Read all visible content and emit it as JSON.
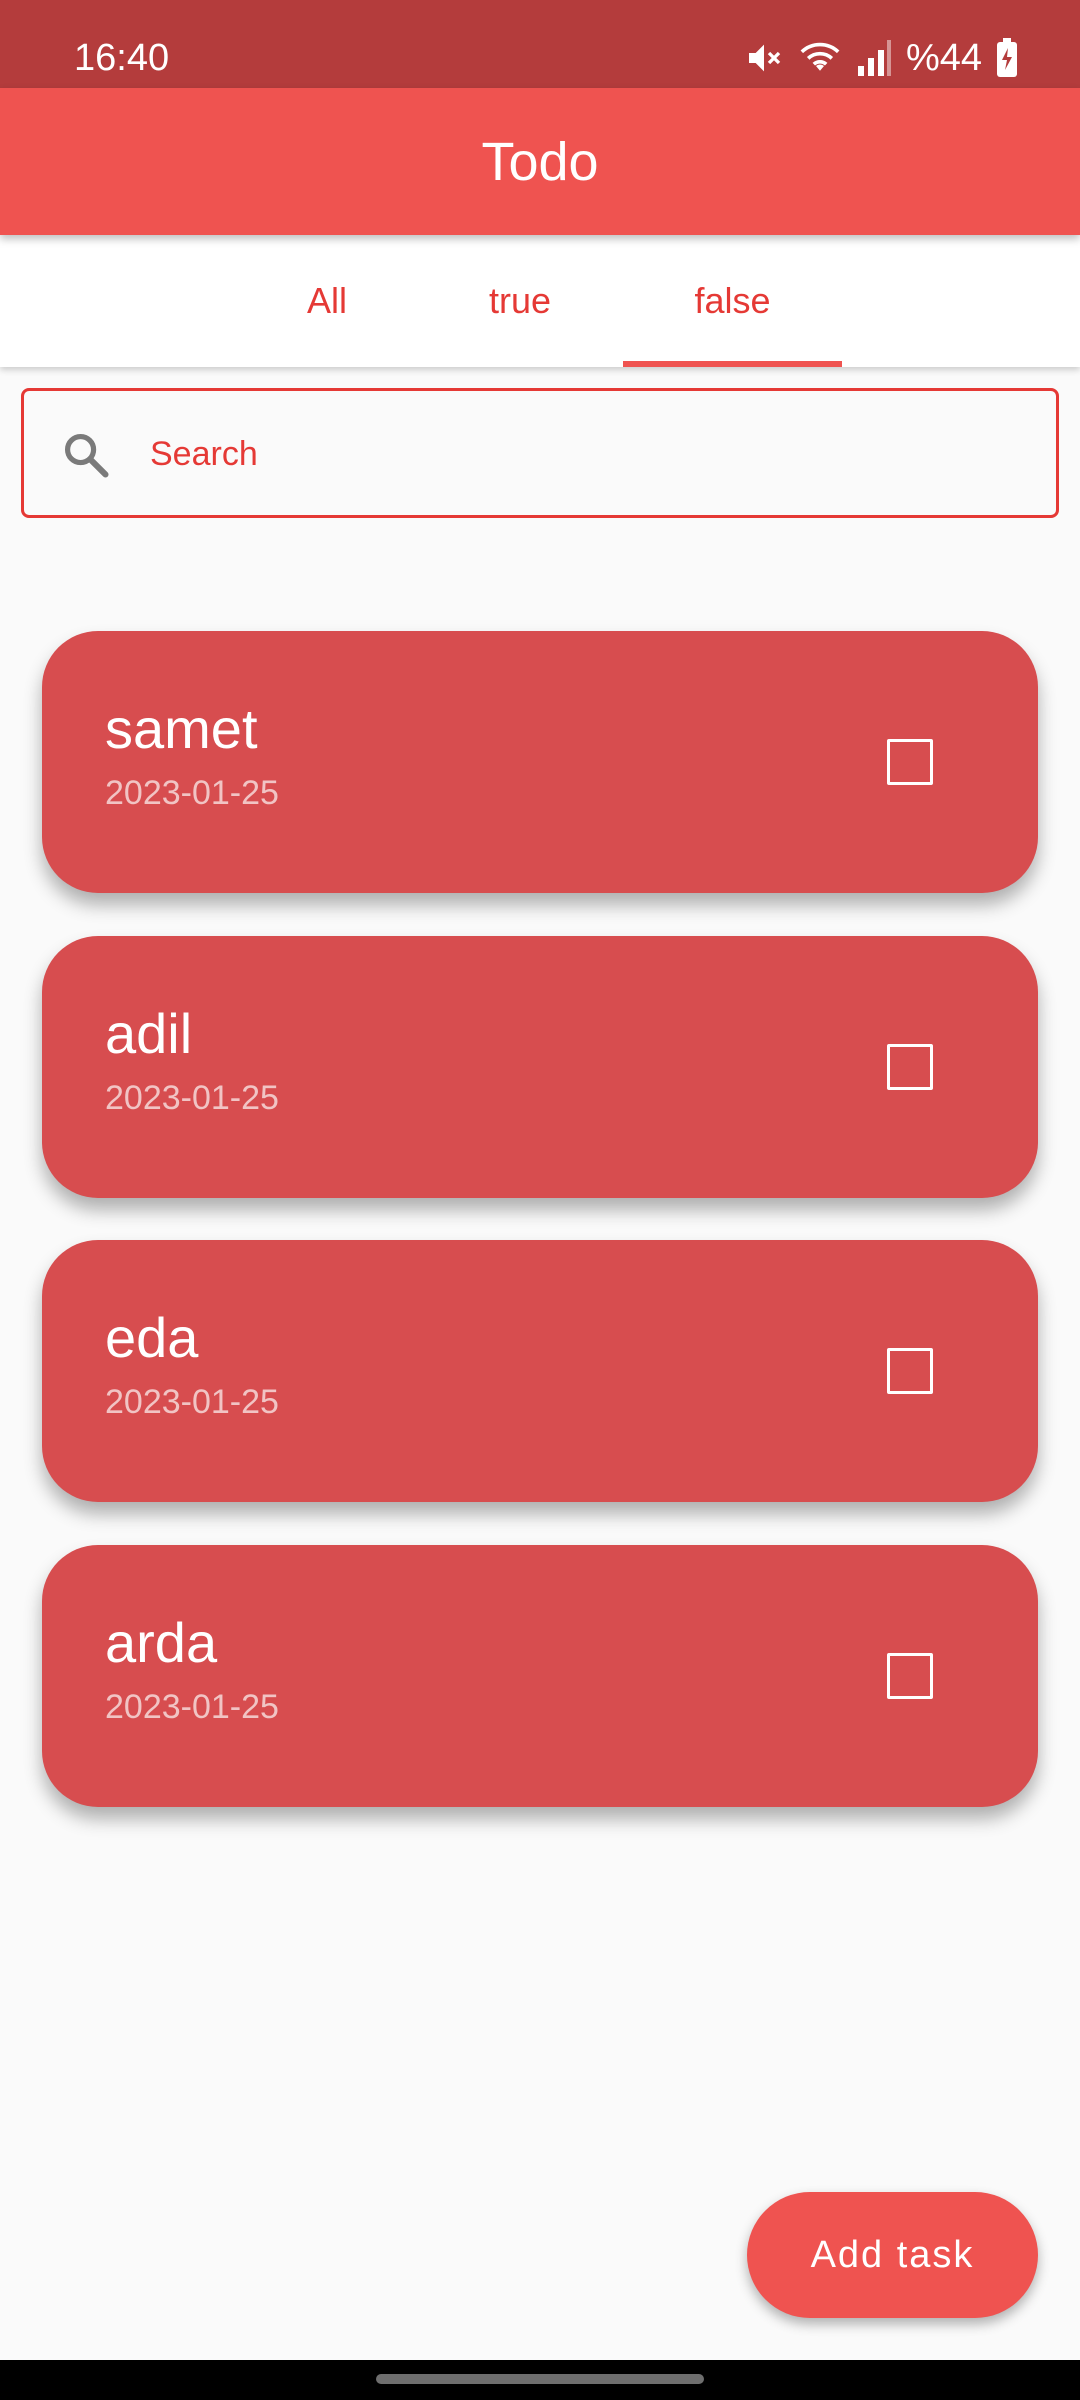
{
  "status_bar": {
    "time": "16:40",
    "battery": "%44",
    "icons": [
      "mute-icon",
      "wifi-icon",
      "signal-icon",
      "battery-charging-icon"
    ]
  },
  "app_bar": {
    "title": "Todo"
  },
  "tabs": [
    {
      "label": "All",
      "selected": false
    },
    {
      "label": "true",
      "selected": false
    },
    {
      "label": "false",
      "selected": true
    }
  ],
  "search": {
    "placeholder": "Search",
    "value": "",
    "icon": "search-icon"
  },
  "tasks": [
    {
      "name": "samet",
      "date": "2023-01-25",
      "done": false
    },
    {
      "name": "adil",
      "date": "2023-01-25",
      "done": false
    },
    {
      "name": "eda",
      "date": "2023-01-25",
      "done": false
    },
    {
      "name": "arda",
      "date": "2023-01-25",
      "done": false
    }
  ],
  "fab": {
    "label": "Add task"
  },
  "colors": {
    "primary": "#ef5350",
    "status_bar": "#b43c3c",
    "card": "#d74d4f",
    "accent_text": "#e53935",
    "background": "#fafafa"
  }
}
